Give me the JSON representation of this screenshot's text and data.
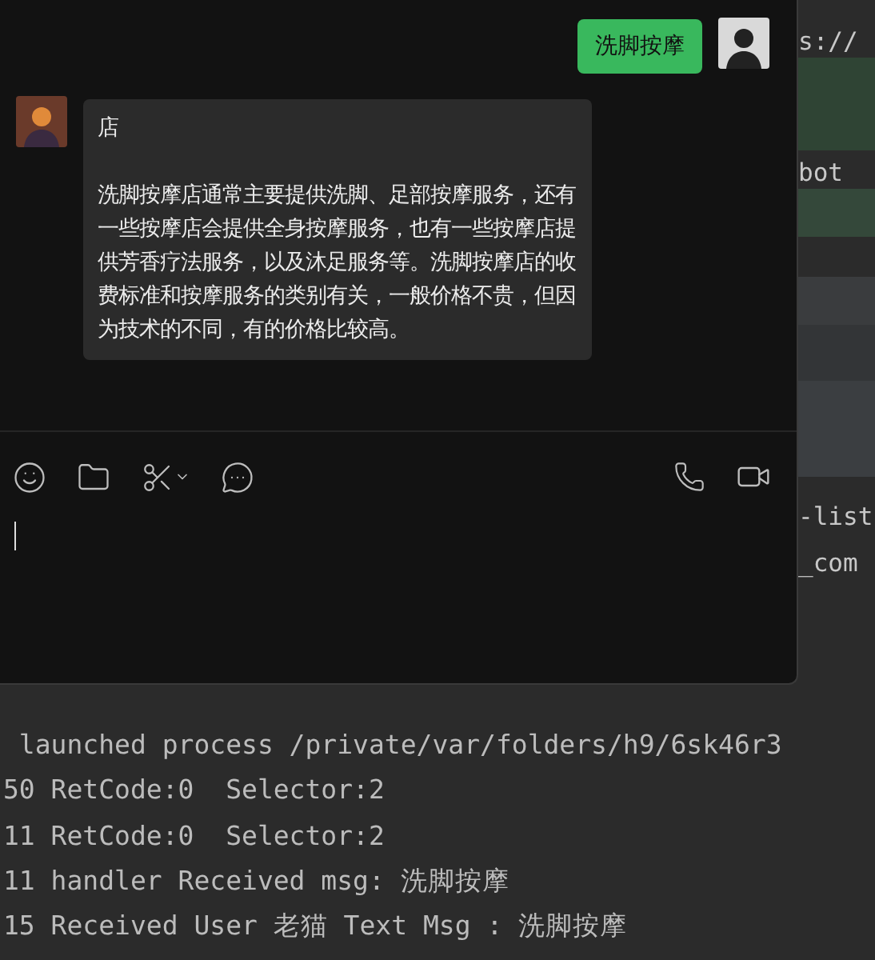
{
  "chat": {
    "messages": [
      {
        "kind": "sent",
        "text": "洗脚按摩"
      },
      {
        "kind": "received",
        "title": "店",
        "text": "洗脚按摩店通常主要提供洗脚、足部按摩服务，还有一些按摩店会提供全身按摩服务，也有一些按摩店提供芳香疗法服务，以及沐足服务等。洗脚按摩店的收费标准和按摩服务的类别有关，一般价格不贵，但因为技术的不同，有的价格比较高。"
      }
    ]
  },
  "editor_fragments": [
    "s://",
    "bot",
    "-list",
    "_com"
  ],
  "terminal": {
    "lines": [
      " launched process /private/var/folders/h9/6sk46r3",
      "50 RetCode:0  Selector:2",
      "11 RetCode:0  Selector:2",
      "11 handler Received msg: 洗脚按摩",
      "15 Received User 老猫 Text Msg : 洗脚按摩"
    ]
  }
}
